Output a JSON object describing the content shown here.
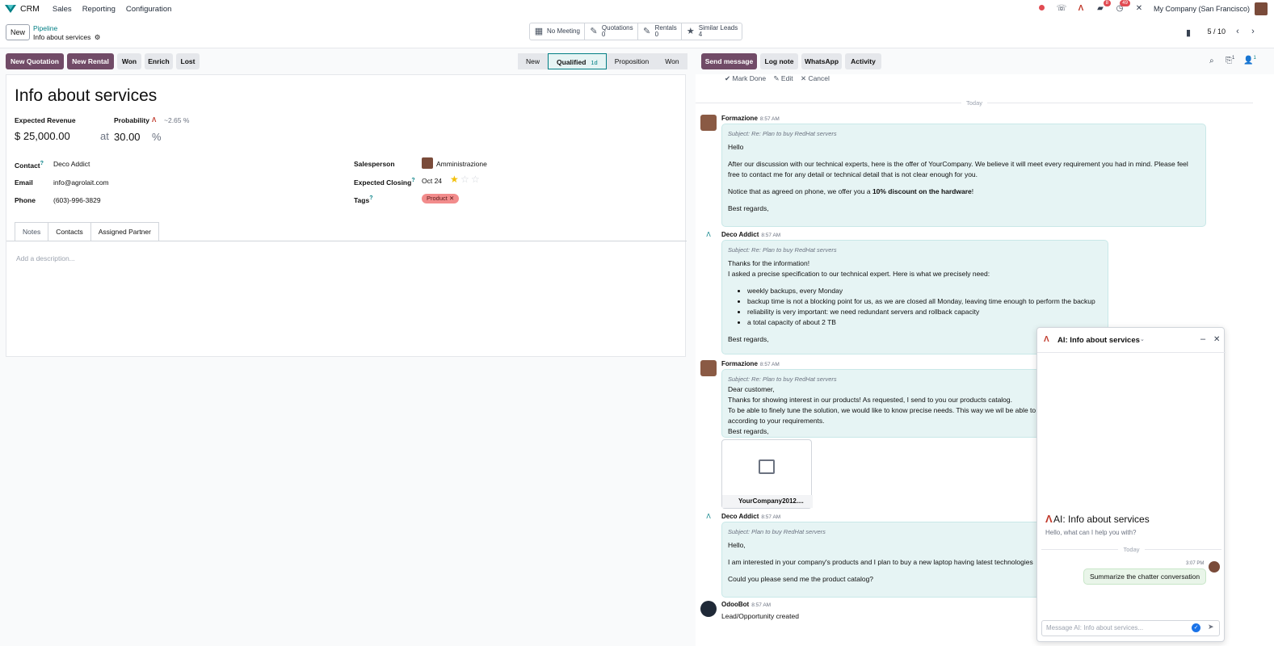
{
  "topbar": {
    "app": "CRM",
    "menus": [
      "Sales",
      "Reporting",
      "Configuration"
    ],
    "badges": {
      "chat": "8",
      "activity": "49"
    },
    "company": "My Company (San Francisco)",
    "colors": {
      "brand": "#017e84",
      "primary": "#714b67"
    }
  },
  "control": {
    "new_label": "New",
    "breadcrumb_parent": "Pipeline",
    "breadcrumb_current": "Info about services",
    "stats": [
      {
        "icon": "calendar-icon",
        "label": "No Meeting",
        "count": ""
      },
      {
        "icon": "edit-icon",
        "label": "Quotations",
        "count": "0"
      },
      {
        "icon": "edit-icon",
        "label": "Rentals",
        "count": "0"
      },
      {
        "icon": "star-icon",
        "label": "Similar Leads",
        "count": "4"
      }
    ],
    "pager": "5 / 10"
  },
  "actions": {
    "new_quotation": "New Quotation",
    "new_rental": "New Rental",
    "won": "Won",
    "enrich": "Enrich",
    "lost": "Lost"
  },
  "stages": [
    {
      "label": "New",
      "current": false
    },
    {
      "label": "Qualified",
      "current": true,
      "duration": "1d"
    },
    {
      "label": "Proposition",
      "current": false
    },
    {
      "label": "Won",
      "current": false
    }
  ],
  "form": {
    "title": "Info about services",
    "expected_revenue_label": "Expected Revenue",
    "expected_revenue": "$ 25,000.00",
    "at": "at",
    "probability_label": "Probability",
    "ai_probability": "~2.65 %",
    "probability": "30.00",
    "percent": "%",
    "contact_label": "Contact",
    "contact": "Deco Addict",
    "email_label": "Email",
    "email": "info@agrolait.com",
    "phone_label": "Phone",
    "phone": "(603)-996-3829",
    "salesperson_label": "Salesperson",
    "salesperson": "Amministrazione",
    "expected_closing_label": "Expected Closing",
    "expected_closing": "Oct 24",
    "priority_stars": 1,
    "tags_label": "Tags",
    "tag": "Product",
    "tabs": [
      "Notes",
      "Contacts",
      "Assigned Partner"
    ],
    "description_placeholder": "Add a description..."
  },
  "chatter": {
    "buttons": {
      "send": "Send message",
      "log": "Log note",
      "whatsapp": "WhatsApp",
      "activity": "Activity"
    },
    "attachments_count": "1",
    "followers_count": "1",
    "activity_actions": {
      "done": "Mark Done",
      "edit": "Edit",
      "cancel": "Cancel"
    },
    "today": "Today",
    "messages": [
      {
        "author": "Formazione",
        "time": "8:57 AM",
        "subject": "Subject: Re: Plan to buy RedHat servers",
        "p1": "Hello",
        "p2": "After our discussion with our technical experts, here is the offer of YourCompany. We believe it will meet every requirement you had in mind. Please feel free to contact me for any detail or technical detail that is not clear enough for you.",
        "p3a": "Notice that as agreed on phone, we offer you a ",
        "p3b": "10% discount on the hardware",
        "p3c": "!",
        "p4": "Best regards,"
      },
      {
        "author": "Deco Addict",
        "time": "8:57 AM",
        "subject": "Subject: Re: Plan to buy RedHat servers",
        "p1": "Thanks for the information!",
        "p2": "I asked a precise specification to our technical expert. Here is what we precisely need:",
        "items": [
          "weekly backups, every Monday",
          "backup time is not a blocking point for us, as we are closed all Monday, leaving time enough to perform the backup",
          "reliability is very important: we need redundant servers and rollback capacity",
          "a total capacity of about 2 TB"
        ],
        "p3": "Best regards,"
      },
      {
        "author": "Formazione",
        "time": "8:57 AM",
        "subject": "Subject: Re: Plan to buy RedHat servers",
        "l1": "Dear customer,",
        "l2": "Thanks for showing interest in our products! As requested, I send to you our products catalog.",
        "l3": "To be able to finely tune the solution, we would like to know precise needs. This way we wil be able to",
        "l4": "according to your requirements.",
        "l5": "Best regards,",
        "attachment": "YourCompany2012...."
      },
      {
        "author": "Deco Addict",
        "time": "8:57 AM",
        "subject": "Subject: Plan to buy RedHat servers",
        "p1": "Hello,",
        "p2": "I am interested in your company's products and I plan to buy a new laptop having latest technologies",
        "p3": "Could you please send me the product catalog?"
      },
      {
        "author": "OdooBot",
        "time": "8:57 AM",
        "p1": "Lead/Opportunity created"
      }
    ]
  },
  "ai": {
    "title": "AI: Info about services",
    "greeting": "Hello, what can I help you with?",
    "today": "Today",
    "msg_time": "3:07 PM",
    "user_msg": "Summarize the chatter conversation",
    "placeholder": "Message AI: Info about services..."
  }
}
